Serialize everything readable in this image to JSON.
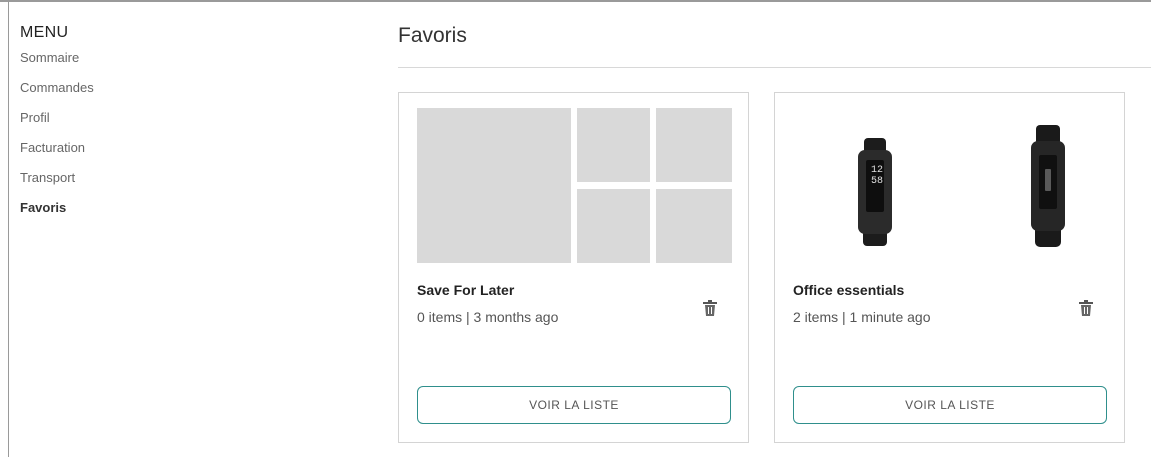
{
  "menu": {
    "title": "MENU",
    "items": [
      {
        "label": "Sommaire",
        "active": false
      },
      {
        "label": "Commandes",
        "active": false
      },
      {
        "label": "Profil",
        "active": false
      },
      {
        "label": "Facturation",
        "active": false
      },
      {
        "label": "Transport",
        "active": false
      },
      {
        "label": "Favoris",
        "active": true
      }
    ]
  },
  "page": {
    "title": "Favoris"
  },
  "lists": [
    {
      "name": "Save For Later",
      "meta": "0 items | 3 months ago",
      "button_label": "VOIR LA LISTE",
      "thumbnail": "placeholder-mosaic",
      "products": []
    },
    {
      "name": "Office essentials",
      "meta": "2 items | 1 minute ago",
      "button_label": "VOIR LA LISTE",
      "thumbnail": "product-images",
      "products": [
        {
          "image": "fitness-tracker-black-icon",
          "screen_text": "12 58"
        },
        {
          "image": "fitness-tracker-black-icon"
        }
      ]
    }
  ],
  "colors": {
    "accent": "#2f8f8c",
    "placeholder": "#d9d9d9",
    "border": "#d4d4d4"
  },
  "icons": {
    "delete": "trash-icon"
  }
}
